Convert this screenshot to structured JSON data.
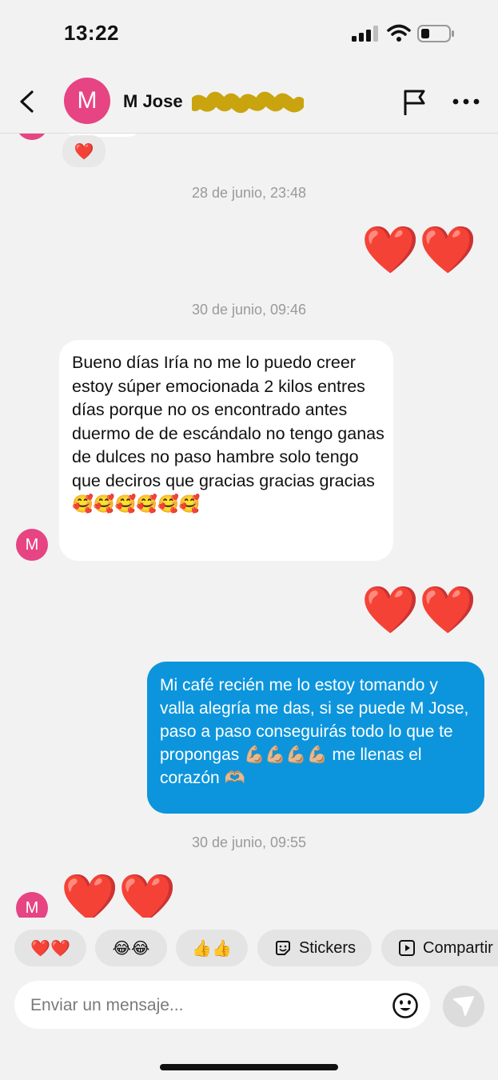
{
  "status": {
    "time": "13:22"
  },
  "header": {
    "contact_name": "M Jose",
    "avatar_initial": "M"
  },
  "chat": {
    "earlier_reaction": "❤️",
    "timestamps": [
      "28 de junio, 23:48",
      "30 de junio, 09:46",
      "30 de junio, 09:55"
    ],
    "sent_hearts_1": "❤️❤️",
    "incoming_message": "Bueno días Iría no me lo puedo creer estoy súper emocionada 2 kilos entres días porque no os encontrado antes duermo de de escándalo no tengo ganas de dulces no paso hambre solo tengo que deciros que gracias gracias gracias🥰🥰🥰🥰🥰🥰",
    "sent_hearts_2": "❤️❤️",
    "outgoing_message": "Mi café recién me lo estoy tomando y valla alegría me das, si se puede M Jose, paso a paso conseguirás todo lo que te propongas 💪🏼💪🏼💪🏼💪🏼 me llenas el corazón 🫶🏼",
    "incoming_hearts": "❤️❤️",
    "avatar_initial": "M"
  },
  "quick_replies": {
    "hearts": "❤️❤️",
    "laughs": "😂😂",
    "thumbs": "👍👍",
    "stickers": "Stickers",
    "share": "Compartir"
  },
  "composer": {
    "placeholder": "Enviar un mensaje..."
  },
  "colors": {
    "outgoing_bubble": "#0c95dc",
    "avatar": "#e64482",
    "background": "#f2f2f2"
  }
}
